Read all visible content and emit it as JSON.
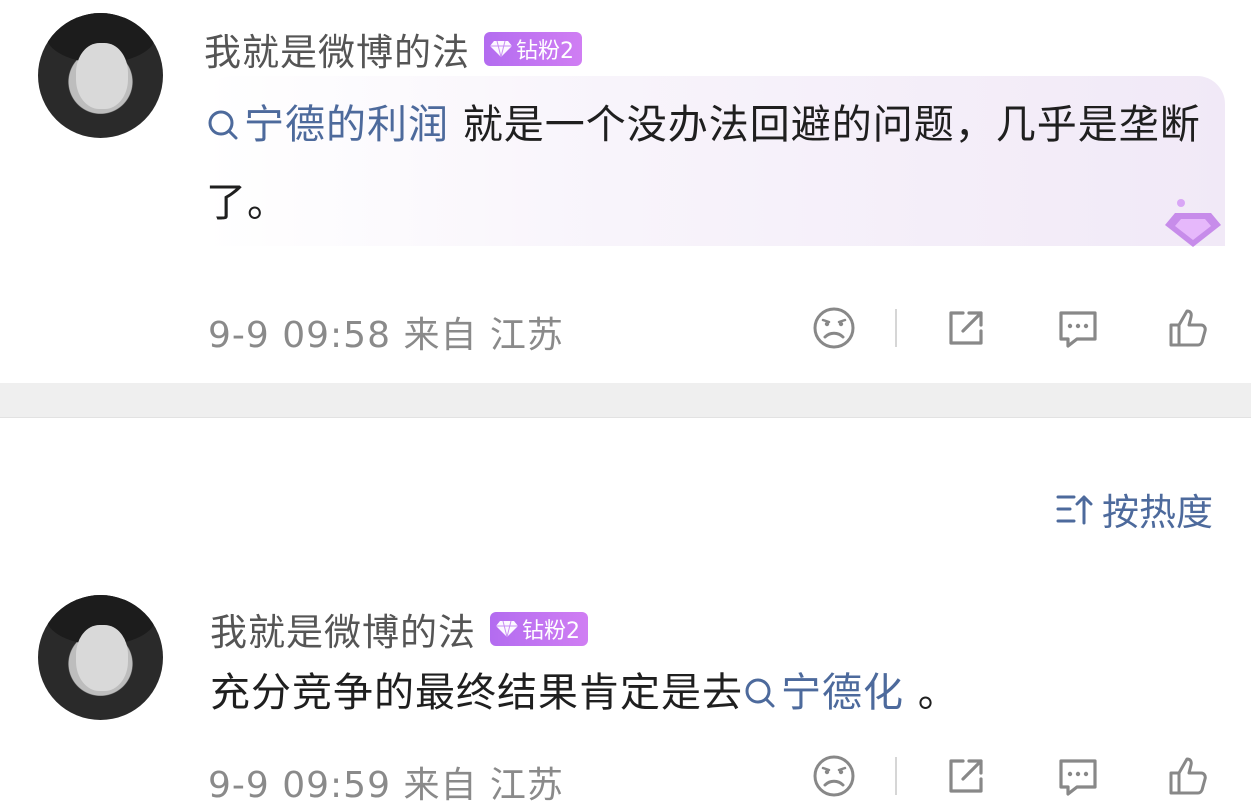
{
  "comments": [
    {
      "username": "我就是微博的法",
      "badge": "钻粉2",
      "topic": "宁德的利润",
      "text_after_topic": " 就是一个没办法回避的问题，几乎是垄断了。",
      "time": "9-9 09:58",
      "location": "来自 江苏"
    },
    {
      "username": "我就是微博的法",
      "badge": "钻粉2",
      "text_before_topic": "充分竞争的最终结果肯定是去",
      "topic": "宁德化",
      "text_after_topic": " 。",
      "time": "9-9 09:59",
      "location": "来自 江苏"
    }
  ],
  "sort": {
    "label": "按热度"
  },
  "icons": [
    "sad-face-icon",
    "share-icon",
    "comment-icon",
    "like-icon",
    "search-icon",
    "sort-icon",
    "diamond-icon"
  ],
  "colors": {
    "topic": "#4d6a9c",
    "badge": "#c277f2",
    "meta": "#8a8a8a"
  }
}
